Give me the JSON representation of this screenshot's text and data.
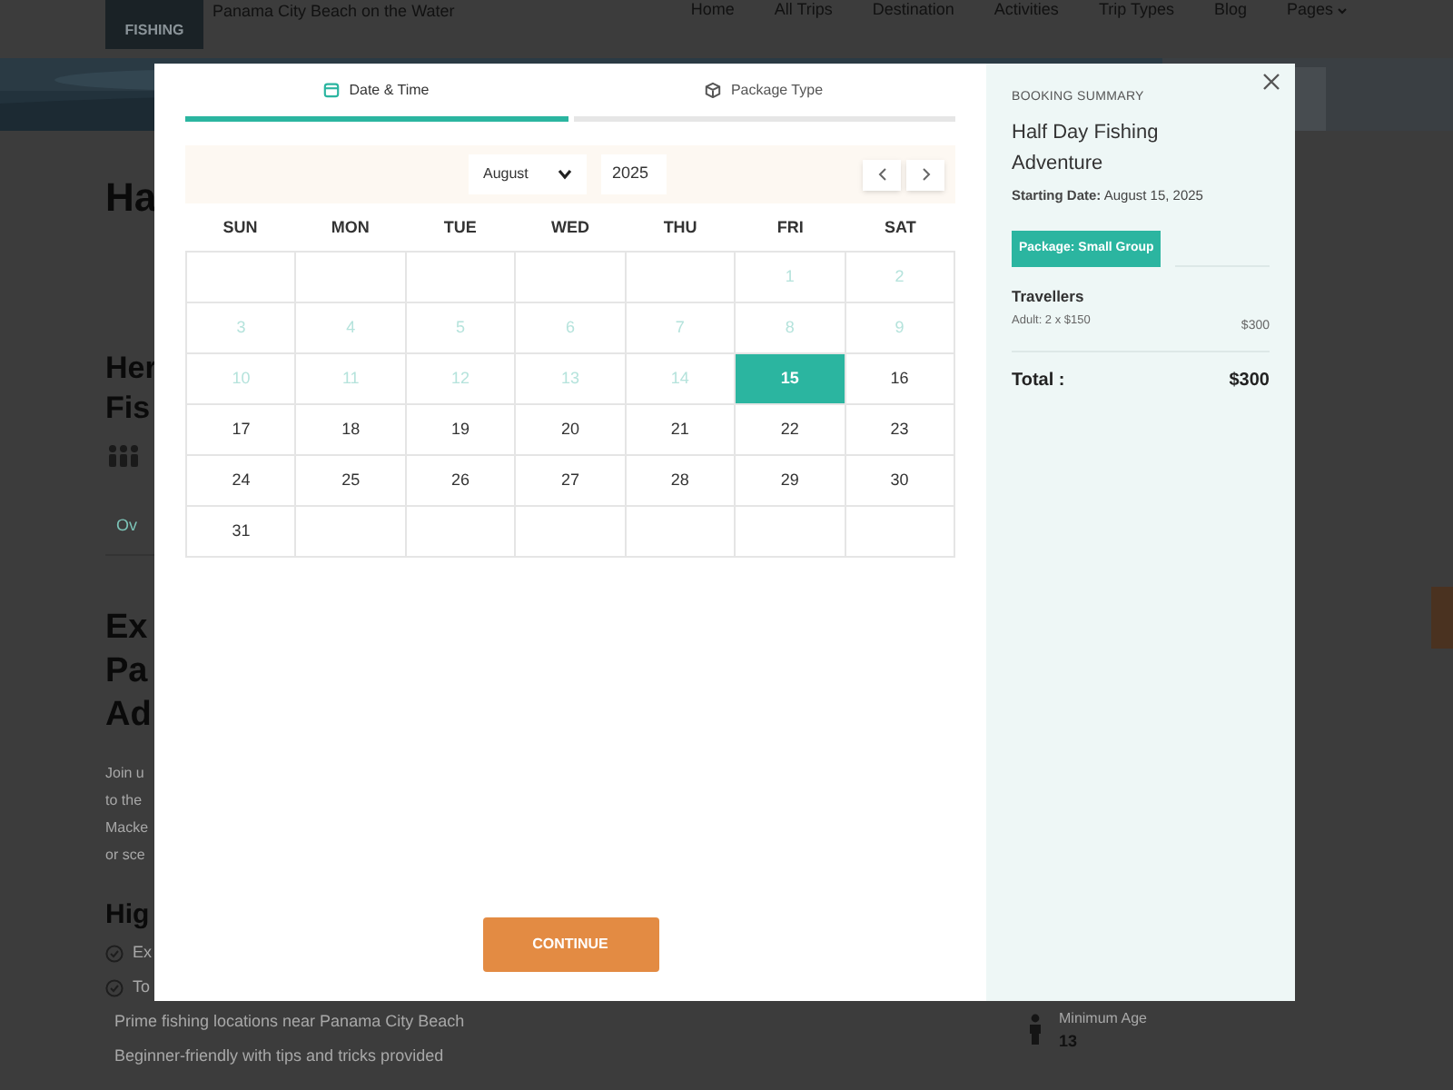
{
  "page": {
    "logo": "FISHING",
    "tagline": "Panama City Beach on the Water",
    "nav": [
      {
        "label": "Home",
        "dropdown": false
      },
      {
        "label": "All Trips",
        "dropdown": false
      },
      {
        "label": "Destination",
        "dropdown": false
      },
      {
        "label": "Activities",
        "dropdown": false
      },
      {
        "label": "Trip Types",
        "dropdown": false
      },
      {
        "label": "Blog",
        "dropdown": false
      },
      {
        "label": "Pages",
        "dropdown": true
      }
    ],
    "title_fragment": "Ha",
    "heading_fragments": [
      "Her",
      "Fis"
    ],
    "tab_fragment": "Ov",
    "section_fragments": [
      "Ex",
      "Pa",
      "Ad"
    ],
    "paragraph_fragments": [
      "Join u",
      "to the",
      "Macke",
      "or sce"
    ],
    "highlights_fragment": "Hig",
    "highlights": [
      "Ex",
      "To",
      "Prime fishing locations near Panama City Beach",
      "Beginner-friendly with tips and tricks provided"
    ],
    "min_age": {
      "label": "Minimum Age",
      "value": "13"
    }
  },
  "modal": {
    "steps": [
      {
        "label": "Date & Time",
        "selected": true
      },
      {
        "label": "Package Type",
        "selected": false
      }
    ],
    "month": "August",
    "year": "2025",
    "weekdays": [
      "SUN",
      "MON",
      "TUE",
      "WED",
      "THU",
      "FRI",
      "SAT"
    ],
    "weeks": [
      [
        {
          "kind": "empty"
        },
        {
          "kind": "empty"
        },
        {
          "kind": "empty"
        },
        {
          "kind": "empty"
        },
        {
          "kind": "empty"
        },
        {
          "kind": "day",
          "day": "1",
          "disabled": true,
          "selected": false
        },
        {
          "kind": "day",
          "day": "2",
          "disabled": true,
          "selected": false
        }
      ],
      [
        {
          "kind": "day",
          "day": "3",
          "disabled": true,
          "selected": false
        },
        {
          "kind": "day",
          "day": "4",
          "disabled": true,
          "selected": false
        },
        {
          "kind": "day",
          "day": "5",
          "disabled": true,
          "selected": false
        },
        {
          "kind": "day",
          "day": "6",
          "disabled": true,
          "selected": false
        },
        {
          "kind": "day",
          "day": "7",
          "disabled": true,
          "selected": false
        },
        {
          "kind": "day",
          "day": "8",
          "disabled": true,
          "selected": false
        },
        {
          "kind": "day",
          "day": "9",
          "disabled": true,
          "selected": false
        }
      ],
      [
        {
          "kind": "day",
          "day": "10",
          "disabled": true,
          "selected": false
        },
        {
          "kind": "day",
          "day": "11",
          "disabled": true,
          "selected": false
        },
        {
          "kind": "day",
          "day": "12",
          "disabled": true,
          "selected": false
        },
        {
          "kind": "day",
          "day": "13",
          "disabled": true,
          "selected": false
        },
        {
          "kind": "day",
          "day": "14",
          "disabled": true,
          "selected": false
        },
        {
          "kind": "day",
          "day": "15",
          "disabled": false,
          "selected": true
        },
        {
          "kind": "day",
          "day": "16",
          "disabled": false,
          "selected": false
        }
      ],
      [
        {
          "kind": "day",
          "day": "17",
          "disabled": false,
          "selected": false
        },
        {
          "kind": "day",
          "day": "18",
          "disabled": false,
          "selected": false
        },
        {
          "kind": "day",
          "day": "19",
          "disabled": false,
          "selected": false
        },
        {
          "kind": "day",
          "day": "20",
          "disabled": false,
          "selected": false
        },
        {
          "kind": "day",
          "day": "21",
          "disabled": false,
          "selected": false
        },
        {
          "kind": "day",
          "day": "22",
          "disabled": false,
          "selected": false
        },
        {
          "kind": "day",
          "day": "23",
          "disabled": false,
          "selected": false
        }
      ],
      [
        {
          "kind": "day",
          "day": "24",
          "disabled": false,
          "selected": false
        },
        {
          "kind": "day",
          "day": "25",
          "disabled": false,
          "selected": false
        },
        {
          "kind": "day",
          "day": "26",
          "disabled": false,
          "selected": false
        },
        {
          "kind": "day",
          "day": "27",
          "disabled": false,
          "selected": false
        },
        {
          "kind": "day",
          "day": "28",
          "disabled": false,
          "selected": false
        },
        {
          "kind": "day",
          "day": "29",
          "disabled": false,
          "selected": false
        },
        {
          "kind": "day",
          "day": "30",
          "disabled": false,
          "selected": false
        }
      ],
      [
        {
          "kind": "day",
          "day": "31",
          "disabled": false,
          "selected": false
        },
        {
          "kind": "empty"
        },
        {
          "kind": "empty"
        },
        {
          "kind": "empty"
        },
        {
          "kind": "empty"
        },
        {
          "kind": "empty"
        },
        {
          "kind": "empty"
        }
      ]
    ],
    "continue": "CONTINUE",
    "summary": {
      "heading": "BOOKING SUMMARY",
      "trip": "Half Day Fishing Adventure",
      "start_label": "Starting Date:",
      "start_value": "August 15, 2025",
      "package": "Package: Small Group",
      "travellers_heading": "Travellers",
      "travellers": [
        {
          "label": "Adult: 2 x $150",
          "amount": "$300"
        }
      ],
      "total_label": "Total :",
      "total": "$300"
    }
  }
}
